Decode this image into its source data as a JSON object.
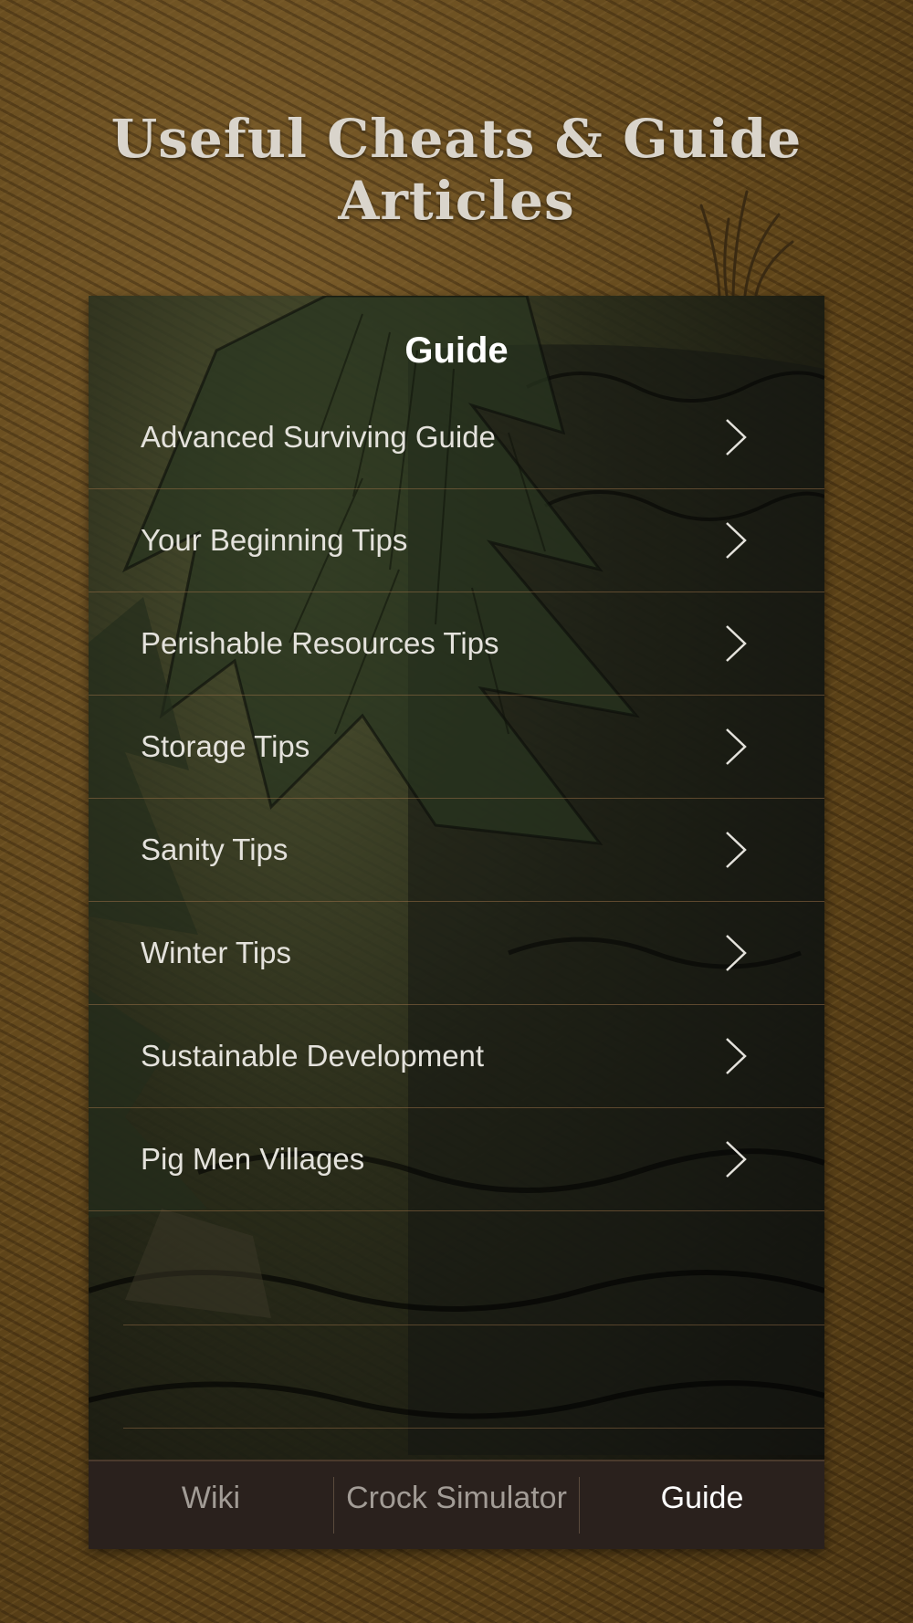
{
  "headline": "Useful Cheats & Guide Articles",
  "navbar": {
    "title": "Guide"
  },
  "guide_items": [
    {
      "label": "Advanced Surviving Guide"
    },
    {
      "label": "Your Beginning Tips"
    },
    {
      "label": "Perishable Resources Tips"
    },
    {
      "label": "Storage Tips"
    },
    {
      "label": "Sanity Tips"
    },
    {
      "label": "Winter Tips"
    },
    {
      "label": "Sustainable Development"
    },
    {
      "label": "Pig Men Villages"
    }
  ],
  "tabbar": {
    "tabs": [
      {
        "label": "Wiki",
        "active": false
      },
      {
        "label": "Crock Simulator",
        "active": false
      },
      {
        "label": "Guide",
        "active": true
      }
    ]
  },
  "colors": {
    "background": "#6b4f22",
    "headline": "#d9d4cb",
    "tabbar": "#2a211d",
    "tab_active": "#ffffff",
    "tab_inactive": "#a29c96",
    "row_separator": "#96704a"
  },
  "icons": {
    "row_disclosure": "chevron-right-icon"
  }
}
